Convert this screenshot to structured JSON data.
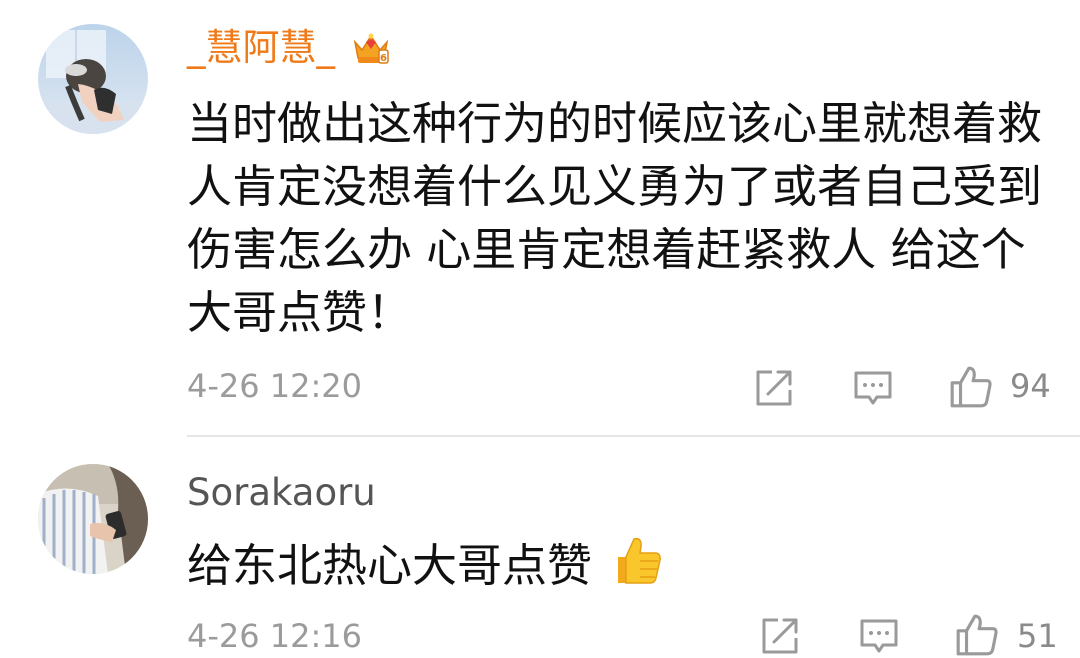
{
  "comments": [
    {
      "username": "_慧阿慧_",
      "username_color": "#ef7a1a",
      "badge_icon": "crown-badge-icon",
      "avatar_icon": "user-avatar",
      "text": "当时做出这种行为的时候应该心里就想着救人肯定没想着什么见义勇为了或者自己受到伤害怎么办 心里肯定想着赶紧救人  给这个大哥点赞！",
      "time": "4-26 12:20",
      "actions": {
        "share_icon": "share-icon",
        "reply_icon": "comment-icon",
        "like_icon": "thumbs-up-icon",
        "like_count": "94"
      }
    },
    {
      "username": "Sorakaoru",
      "username_color": "#555555",
      "avatar_icon": "user-avatar",
      "text": "给东北热心大哥点赞",
      "emoji": "thumbs-up-emoji",
      "time": "4-26 12:16",
      "actions": {
        "share_icon": "share-icon",
        "reply_icon": "comment-icon",
        "like_icon": "thumbs-up-icon",
        "like_count": "51"
      }
    }
  ]
}
